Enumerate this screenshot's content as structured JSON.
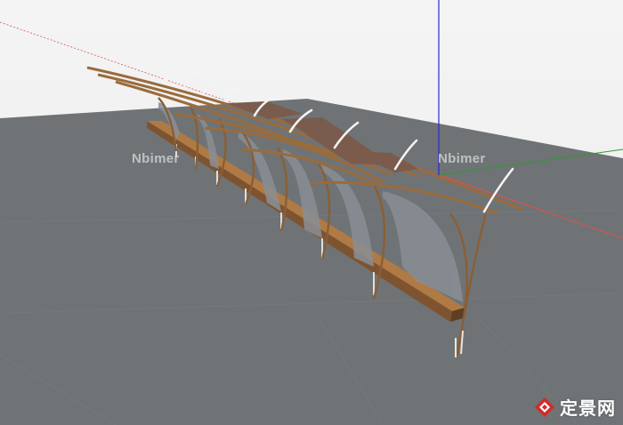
{
  "watermarks": {
    "left": "Nbimer",
    "right": "Nbimer"
  },
  "brand": {
    "text": "定景网",
    "logo_icon": "diamond-logo-icon"
  },
  "colors": {
    "sky": "#f2f2f2",
    "ground": "#6e7274",
    "axis_red": "#d9534f",
    "axis_green": "#2e9b2e",
    "axis_blue": "#2a2ad0",
    "wood": "#9a6b3c",
    "brand_red": "#d42a2a"
  }
}
